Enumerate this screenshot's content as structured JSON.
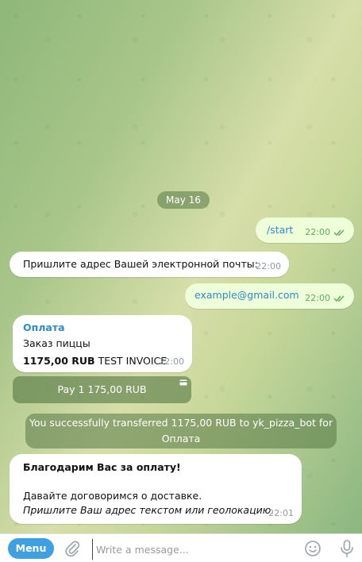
{
  "date_label": "May 16",
  "messages": [
    {
      "direction": "out",
      "text": "/start",
      "time": "22:00"
    },
    {
      "direction": "in",
      "text": "Пришлите адрес Вашей электронной почты:",
      "time": "22:00"
    },
    {
      "direction": "out",
      "text": "example@gmail.com",
      "time": "22:00"
    }
  ],
  "invoice": {
    "title": "Оплата",
    "description": "Заказ пиццы",
    "amount": "1175,00 RUB",
    "tag": "TEST INVOICE",
    "time": "22:00",
    "pay_button": "Pay 1 175,00 RUB"
  },
  "service_message": "You successfully transferred 1175,00 RUB to yk_pizza_bot for Оплата",
  "thanks": {
    "title": "Благодарим Вас за оплату!",
    "line1": "Давайте договоримся о доставке.",
    "line2": "Пришлите Ваш адрес текстом или геолокацию.",
    "time": "22:01"
  },
  "composer": {
    "menu_label": "Menu",
    "placeholder": "Write a message..."
  },
  "colors": {
    "accent": "#3ea0e0",
    "outgoing_bubble": "#eefed9",
    "link": "#2e8bc8"
  }
}
